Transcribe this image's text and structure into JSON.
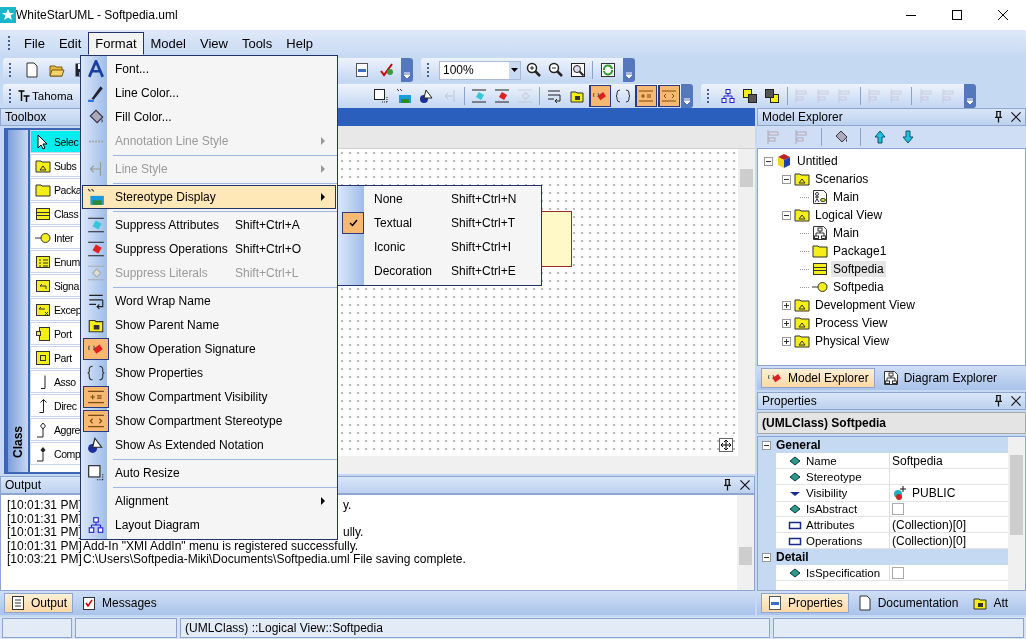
{
  "window": {
    "title": "WhiteStarUML - Softpedia.uml"
  },
  "menu_bar": [
    {
      "label": "File",
      "selected": false
    },
    {
      "label": "Edit",
      "selected": false
    },
    {
      "label": "Format",
      "selected": true
    },
    {
      "label": "Model",
      "selected": false
    },
    {
      "label": "View",
      "selected": false
    },
    {
      "label": "Tools",
      "selected": false
    },
    {
      "label": "Help",
      "selected": false
    }
  ],
  "toolbar_1": {
    "zoom": "100%"
  },
  "toolbar_2": {
    "font": "Tahoma",
    "buttons": [
      {
        "checked": false,
        "disabled": false
      },
      {
        "checked": false,
        "disabled": false
      },
      {
        "checked": false,
        "disabled": false
      },
      {
        "checked": false,
        "disabled": true
      },
      {
        "checked": false,
        "disabled": false
      },
      {
        "checked": false,
        "disabled": false
      },
      {
        "checked": false,
        "disabled": true
      },
      {
        "checked": false,
        "disabled": false
      },
      {
        "checked": false,
        "disabled": false
      },
      {
        "checked": true,
        "disabled": false
      },
      {
        "checked": false,
        "disabled": false
      },
      {
        "checked": true,
        "disabled": false
      },
      {
        "checked": true,
        "disabled": false
      }
    ]
  },
  "toolbar_3": {
    "buttons": [
      {
        "disabled": false
      },
      {
        "disabled": false
      },
      {
        "disabled": false
      },
      {
        "disabled": true
      },
      {
        "disabled": true
      },
      {
        "disabled": true
      },
      {
        "disabled": true
      },
      {
        "disabled": true
      },
      {
        "disabled": true
      },
      {
        "disabled": true
      }
    ]
  },
  "toolbox": {
    "title": "Toolbox",
    "group": "Class",
    "items": [
      {
        "label": "Selec",
        "kind": "select",
        "selected": true
      },
      {
        "label": "Subs",
        "kind": "subsystem",
        "selected": false
      },
      {
        "label": "Packa",
        "kind": "package",
        "selected": false
      },
      {
        "label": "Class",
        "kind": "class",
        "selected": false
      },
      {
        "label": "Inter",
        "kind": "interface",
        "selected": false
      },
      {
        "label": "Enum",
        "kind": "enum",
        "selected": false
      },
      {
        "label": "Signa",
        "kind": "signal",
        "selected": false
      },
      {
        "label": "Excep",
        "kind": "exception",
        "selected": false
      },
      {
        "label": "Port",
        "kind": "port",
        "selected": false
      },
      {
        "label": "Part",
        "kind": "part",
        "selected": false
      },
      {
        "label": "Asso",
        "kind": "association",
        "selected": false
      },
      {
        "label": "Direc",
        "kind": "directed",
        "selected": false
      },
      {
        "label": "Aggre",
        "kind": "aggregation",
        "selected": false
      },
      {
        "label": "Comp",
        "kind": "composition",
        "selected": false
      }
    ]
  },
  "format_menu": [
    {
      "kind": "item",
      "label": "Font...",
      "disabled": false,
      "checked": false,
      "selected": false,
      "submenu": false
    },
    {
      "kind": "item",
      "label": "Line Color...",
      "disabled": false,
      "checked": false,
      "selected": false,
      "submenu": false
    },
    {
      "kind": "item",
      "label": "Fill Color...",
      "disabled": false,
      "checked": false,
      "selected": false,
      "submenu": false
    },
    {
      "kind": "item",
      "label": "Annotation Line Style",
      "disabled": true,
      "checked": false,
      "selected": false,
      "submenu": true
    },
    {
      "kind": "separator"
    },
    {
      "kind": "item",
      "label": "Line Style",
      "disabled": true,
      "checked": false,
      "selected": false,
      "submenu": true
    },
    {
      "kind": "separator"
    },
    {
      "kind": "item",
      "label": "Stereotype Display",
      "disabled": false,
      "checked": false,
      "selected": true,
      "submenu": true
    },
    {
      "kind": "separator"
    },
    {
      "kind": "item",
      "label": "Suppress Attributes",
      "shortcut": "Shift+Ctrl+A",
      "disabled": false,
      "checked": false,
      "selected": false,
      "submenu": false
    },
    {
      "kind": "item",
      "label": "Suppress Operations",
      "shortcut": "Shift+Ctrl+O",
      "disabled": false,
      "checked": false,
      "selected": false,
      "submenu": false
    },
    {
      "kind": "item",
      "label": "Suppress Literals",
      "shortcut": "Shift+Ctrl+L",
      "disabled": true,
      "checked": false,
      "selected": false,
      "submenu": false
    },
    {
      "kind": "separator"
    },
    {
      "kind": "item",
      "label": "Word Wrap Name",
      "disabled": false,
      "checked": false,
      "selected": false,
      "submenu": false
    },
    {
      "kind": "item",
      "label": "Show Parent Name",
      "disabled": false,
      "checked": false,
      "selected": false,
      "submenu": false
    },
    {
      "kind": "item",
      "label": "Show Operation Signature",
      "disabled": false,
      "checked": true,
      "selected": false,
      "submenu": false
    },
    {
      "kind": "item",
      "label": "Show Properties",
      "disabled": false,
      "checked": false,
      "selected": false,
      "submenu": false
    },
    {
      "kind": "item",
      "label": "Show Compartment Visibility",
      "disabled": false,
      "checked": true,
      "selected": false,
      "submenu": false
    },
    {
      "kind": "item",
      "label": "Show Compartment Stereotype",
      "disabled": false,
      "checked": true,
      "selected": false,
      "submenu": false
    },
    {
      "kind": "item",
      "label": "Show As Extended Notation",
      "disabled": false,
      "checked": false,
      "selected": false,
      "submenu": false
    },
    {
      "kind": "separator"
    },
    {
      "kind": "item",
      "label": "Auto Resize",
      "disabled": false,
      "checked": false,
      "selected": false,
      "submenu": false
    },
    {
      "kind": "separator"
    },
    {
      "kind": "item",
      "label": "Alignment",
      "disabled": false,
      "checked": false,
      "selected": false,
      "submenu": true
    },
    {
      "kind": "item",
      "label": "Layout Diagram",
      "disabled": false,
      "checked": false,
      "selected": false,
      "submenu": false
    }
  ],
  "stereotype_submenu": [
    {
      "label": "None",
      "shortcut": "Shift+Ctrl+N",
      "checked": false
    },
    {
      "label": "Textual",
      "shortcut": "Shift+Ctrl+T",
      "checked": true
    },
    {
      "label": "Iconic",
      "shortcut": "Shift+Ctrl+I",
      "checked": false
    },
    {
      "label": "Decoration",
      "shortcut": "Shift+Ctrl+E",
      "checked": false
    }
  ],
  "output": {
    "title": "Output",
    "lines": [
      {
        "time": "[10:01:31 PM]",
        "kind": "tail",
        "text": "y."
      },
      {
        "time": "[10:01:31 PM]"
      },
      {
        "time": "[10:01:31 PM]",
        "kind": "tail",
        "text": "ully."
      },
      {
        "time": "[10:01:31 PM]",
        "kind": "full",
        "text": "Add-In \"XMI AddIn\" menu is registered successfully."
      },
      {
        "time": "[10:03:21 PM]",
        "kind": "full",
        "text": "C:\\Users\\Softpedia-Miki\\Documents\\Softpedia.uml File saving complete."
      }
    ],
    "tabs": [
      {
        "label": "Output",
        "selected": true
      },
      {
        "label": "Messages",
        "selected": false
      }
    ]
  },
  "model_explorer": {
    "title": "Model Explorer",
    "tree": [
      {
        "label": "Untitled",
        "kind": "project",
        "expanded": true,
        "selected": false,
        "children": [
          {
            "label": "Scenarios",
            "kind": "folder",
            "expanded": true,
            "selected": false,
            "children": [
              {
                "label": "Main",
                "kind": "usecase-diagram",
                "selected": false
              }
            ]
          },
          {
            "label": "Logical View",
            "kind": "folder",
            "expanded": true,
            "selected": false,
            "children": [
              {
                "label": "Main",
                "kind": "class-diagram",
                "selected": false
              },
              {
                "label": "Package1",
                "kind": "package",
                "selected": false
              },
              {
                "label": "Softpedia",
                "kind": "class",
                "selected": true
              },
              {
                "label": "Softpedia",
                "kind": "interface",
                "selected": false
              }
            ]
          },
          {
            "label": "Development View",
            "kind": "folder",
            "expanded": false,
            "selected": false
          },
          {
            "label": "Process View",
            "kind": "folder",
            "expanded": false,
            "selected": false
          },
          {
            "label": "Physical View",
            "kind": "folder",
            "expanded": false,
            "selected": false
          }
        ]
      }
    ],
    "tabs": [
      {
        "label": "Model Explorer",
        "selected": true
      },
      {
        "label": "Diagram Explorer",
        "selected": false
      }
    ]
  },
  "properties": {
    "title": "Properties",
    "subject": "(UMLClass) Softpedia",
    "sections": [
      {
        "title": "General",
        "expanded": true,
        "rows": [
          {
            "name": "Name",
            "kind": "text",
            "value": "Softpedia"
          },
          {
            "name": "Stereotype",
            "kind": "text"
          },
          {
            "name": "Visibility",
            "kind": "enum",
            "value": "PUBLIC"
          },
          {
            "name": "IsAbstract",
            "kind": "checkbox",
            "checked": false
          },
          {
            "name": "Attributes",
            "kind": "collection",
            "value": "(Collection)[0]"
          },
          {
            "name": "Operations",
            "kind": "collection",
            "value": "(Collection)[0]"
          }
        ]
      },
      {
        "title": "Detail",
        "expanded": true,
        "rows": [
          {
            "name": "IsSpecification",
            "kind": "checkbox",
            "checked": false
          }
        ]
      }
    ],
    "tabs": [
      {
        "label": "Properties",
        "selected": true
      },
      {
        "label": "Documentation",
        "selected": false
      },
      {
        "label": "Att",
        "selected": false
      }
    ]
  },
  "status_bar": {
    "text": "(UMLClass) ::Logical View::Softpedia"
  }
}
